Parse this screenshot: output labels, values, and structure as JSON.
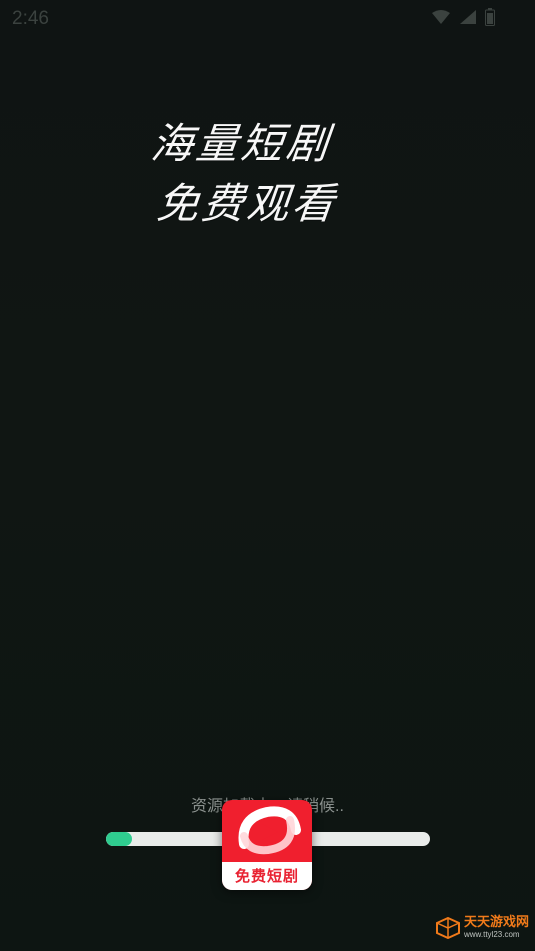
{
  "status_bar": {
    "time": "2:46",
    "icons": [
      "wifi-icon",
      "signal-icon",
      "battery-icon"
    ]
  },
  "slogan": {
    "line1": "海量短剧",
    "line2": "免费观看"
  },
  "loading": {
    "message": "资源加载中，请稍候..",
    "progress": 0.08,
    "track_color": "#e9ecea",
    "fill_color": "#2fcc8f"
  },
  "app_badge": {
    "label": "免费短剧",
    "icon": "play-swirl-icon",
    "color": "#f01f2e"
  },
  "watermark": {
    "title": "天天游戏网",
    "url": "www.ttyl23.com",
    "icon": "cube-logo-icon"
  }
}
